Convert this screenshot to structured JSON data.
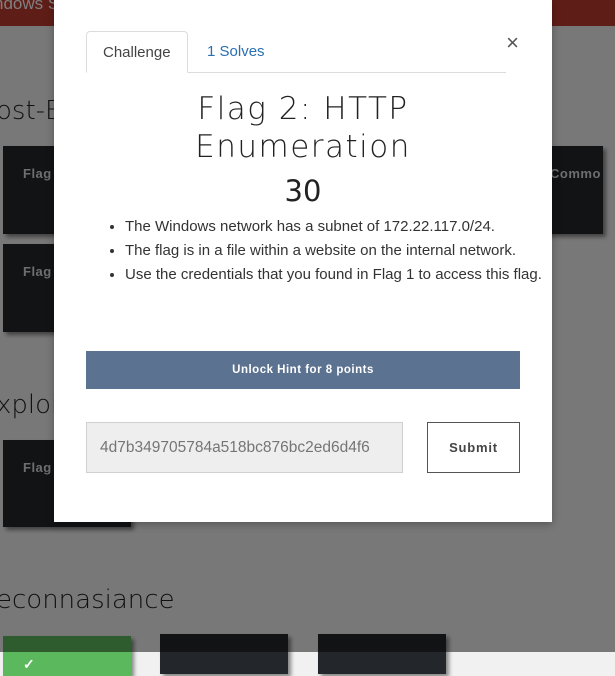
{
  "background": {
    "brand": "ndows S",
    "sections": [
      "ost-E",
      "xploit",
      "econnasiance"
    ],
    "cards": [
      "Flag",
      "Flag",
      "Commo",
      "Flag"
    ],
    "check_icon": "✓"
  },
  "modal": {
    "close_label": "×",
    "tabs": [
      {
        "label": "Challenge",
        "active": true
      },
      {
        "label": "1 Solves",
        "active": false
      }
    ],
    "title_line1": "Flag 2: HTTP",
    "title_line2": "Enumeration",
    "points": "30",
    "description": [
      "The Windows network has a subnet of 172.22.117.0/24.",
      "The flag is in a file within a website on the internal network.",
      "Use the credentials that you found in Flag 1 to access this flag."
    ],
    "hint_button": "Unlock Hint for 8 points",
    "flag_input": {
      "placeholder": "4d7b349705784a518bc876bc2ed6d4f6"
    },
    "submit_label": "Submit"
  },
  "colors": {
    "topbar": "#bf3b2e",
    "hint_button": "#5b7290",
    "card": "#23262b",
    "solved": "#5cb85c",
    "link": "#2a6fb0"
  }
}
